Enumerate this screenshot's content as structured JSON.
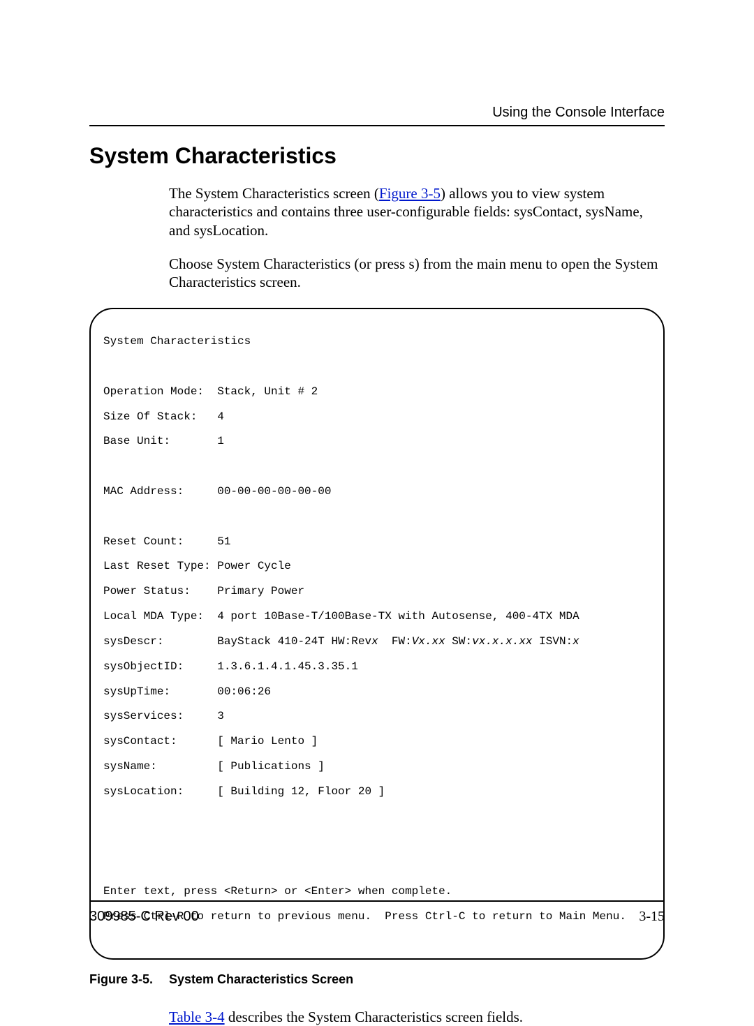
{
  "running_head": "Using the Console Interface",
  "section_title": "System Characteristics",
  "para1_pre": "The System Characteristics screen (",
  "para1_link": "Figure 3-5",
  "para1_post": ") allows you to view system characteristics and contains three user-configurable fields: sysContact, sysName, and sysLocation.",
  "para2": "Choose System Characteristics (or press s) from the main menu to open the System Characteristics screen.",
  "screen": {
    "title": "System Characteristics",
    "op_mode_label": "Operation Mode:",
    "op_mode_val": "Stack, Unit # 2",
    "size_label": "Size Of Stack:",
    "size_val": "4",
    "base_label": "Base Unit:",
    "base_val": "1",
    "mac_label": "MAC Address:",
    "mac_val": "00-00-00-00-00-00",
    "reset_count_label": "Reset Count:",
    "reset_count_val": "51",
    "last_reset_label": "Last Reset Type:",
    "last_reset_val": "Power Cycle",
    "power_label": "Power Status:",
    "power_val": "Primary Power",
    "mda_label": "Local MDA Type:",
    "mda_val": "4 port 10Base-T/100Base-TX with Autosense, 400-4TX MDA",
    "sysdescr_label": "sysDescr:",
    "sysdescr_pre": "BayStack 410-24T HW:Rev",
    "sysdescr_x1": "x",
    "sysdescr_mid1": "  FW:",
    "sysdescr_fw": "Vx.xx",
    "sysdescr_mid2": " SW:",
    "sysdescr_sw": "vx.x.x.xx",
    "sysdescr_mid3": " ISVN:",
    "sysdescr_x2": "x",
    "oid_label": "sysObjectID:",
    "oid_val": "1.3.6.1.4.1.45.3.35.1",
    "uptime_label": "sysUpTime:",
    "uptime_val": "00:06:26",
    "services_label": "sysServices:",
    "services_val": "3",
    "contact_label": "sysContact:",
    "contact_val": "[ Mario Lento ]",
    "name_label": "sysName:",
    "name_val": "[ Publications ]",
    "loc_label": "sysLocation:",
    "loc_val": "[ Building 12, Floor 20 ]",
    "help1": "Enter text, press <Return> or <Enter> when complete.",
    "help2": "Press Ctrl-R to return to previous menu.  Press Ctrl-C to return to Main Menu."
  },
  "caption_num": "Figure 3-5.",
  "caption_text": "System Characteristics Screen",
  "para3_link": "Table 3-4",
  "para3_post": " describes the System Characteristics screen fields.",
  "footer_left": "309985-C Rev 00",
  "footer_right": "3-15"
}
